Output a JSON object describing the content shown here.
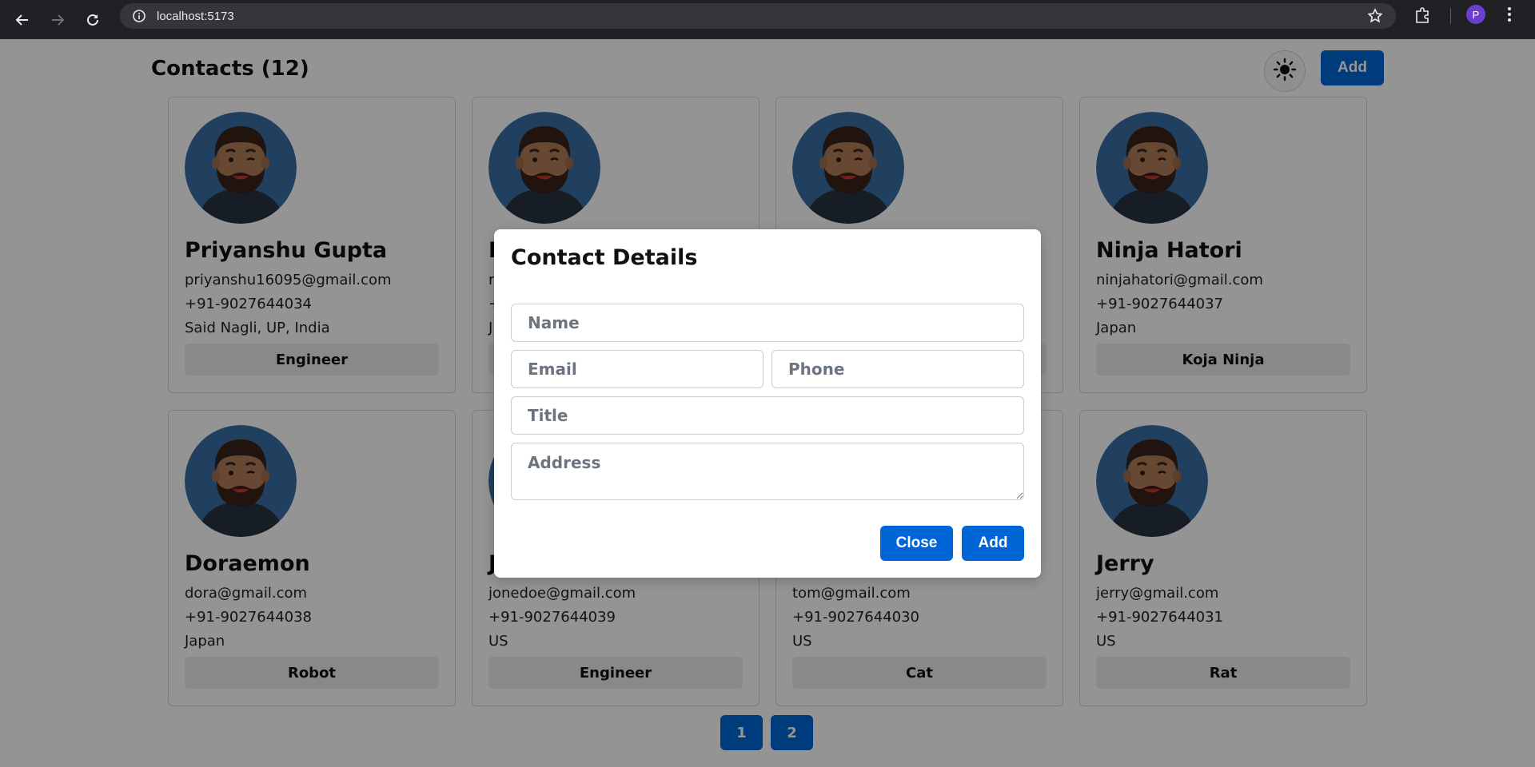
{
  "browser": {
    "url": "localhost:5173",
    "profile_initial": "P",
    "icons": [
      "back-arrow-icon",
      "forward-arrow-icon",
      "reload-icon",
      "site-info-icon",
      "bookmark-star-icon",
      "extensions-icon",
      "kebab-menu-icon"
    ]
  },
  "header": {
    "title": "Contacts (12)",
    "theme_icon": "sun-icon",
    "add_label": "Add"
  },
  "contacts": [
    {
      "name": "Priyanshu Gupta",
      "email": "priyanshu16095@gmail.com",
      "phone": "+91-9027644034",
      "address": "Said Nagli, UP, India",
      "title": "Engineer"
    },
    {
      "name": "N",
      "email": "n",
      "phone": "+",
      "address": "J",
      "title": ""
    },
    {
      "name": "",
      "email": "",
      "phone": "",
      "address": "",
      "title": ""
    },
    {
      "name": "Ninja Hatori",
      "email": "ninjahatori@gmail.com",
      "phone": "+91-9027644037",
      "address": "Japan",
      "title": "Koja Ninja"
    },
    {
      "name": "Doraemon",
      "email": "dora@gmail.com",
      "phone": "+91-9027644038",
      "address": "Japan",
      "title": "Robot"
    },
    {
      "name": "J",
      "email": "jonedoe@gmail.com",
      "phone": "+91-9027644039",
      "address": "US",
      "title": "Engineer"
    },
    {
      "name": "",
      "email": "tom@gmail.com",
      "phone": "+91-9027644030",
      "address": "US",
      "title": "Cat"
    },
    {
      "name": "Jerry",
      "email": "jerry@gmail.com",
      "phone": "+91-9027644031",
      "address": "US",
      "title": "Rat"
    }
  ],
  "pagination": {
    "pages": [
      "1",
      "2"
    ]
  },
  "modal": {
    "title": "Contact Details",
    "name_placeholder": "Name",
    "email_placeholder": "Email",
    "phone_placeholder": "Phone",
    "title_placeholder": "Title",
    "address_placeholder": "Address",
    "close_label": "Close",
    "add_label": "Add"
  },
  "colors": {
    "primary": "#0066d6",
    "chrome_bg": "#202124",
    "avatar_bg": "#3a6ea5"
  }
}
